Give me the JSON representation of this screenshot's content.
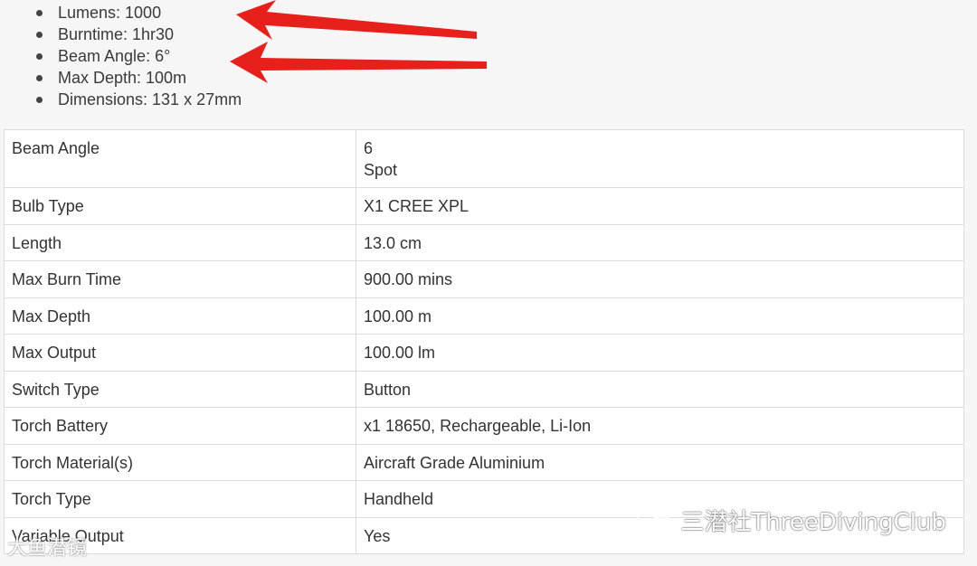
{
  "specs": [
    "Lumens: 1000",
    "Burntime: 1hr30",
    "Beam Angle: 6°",
    "Max Depth: 100m",
    "Dimensions: 131 x 27mm"
  ],
  "table": [
    {
      "label": "Beam Angle",
      "value": "6",
      "value2": "Spot"
    },
    {
      "label": "Bulb Type",
      "value": "X1 CREE XPL"
    },
    {
      "label": "Length",
      "value": "13.0 cm"
    },
    {
      "label": "Max Burn Time",
      "value": "900.00 mins"
    },
    {
      "label": "Max Depth",
      "value": "100.00 m"
    },
    {
      "label": "Max Output",
      "value": "100.00 lm"
    },
    {
      "label": "Switch Type",
      "value": "Button"
    },
    {
      "label": "Torch Battery",
      "value": "x1 18650, Rechargeable, Li-Ion"
    },
    {
      "label": "Torch Material(s)",
      "value": "Aircraft Grade Aluminium"
    },
    {
      "label": "Torch Type",
      "value": "Handheld"
    },
    {
      "label": "Variable Output",
      "value": "Yes"
    }
  ],
  "watermark": "三潜社ThreeDivingClub",
  "watermark_left": "大鱼潜镜",
  "colors": {
    "arrow": "#e8201c"
  }
}
